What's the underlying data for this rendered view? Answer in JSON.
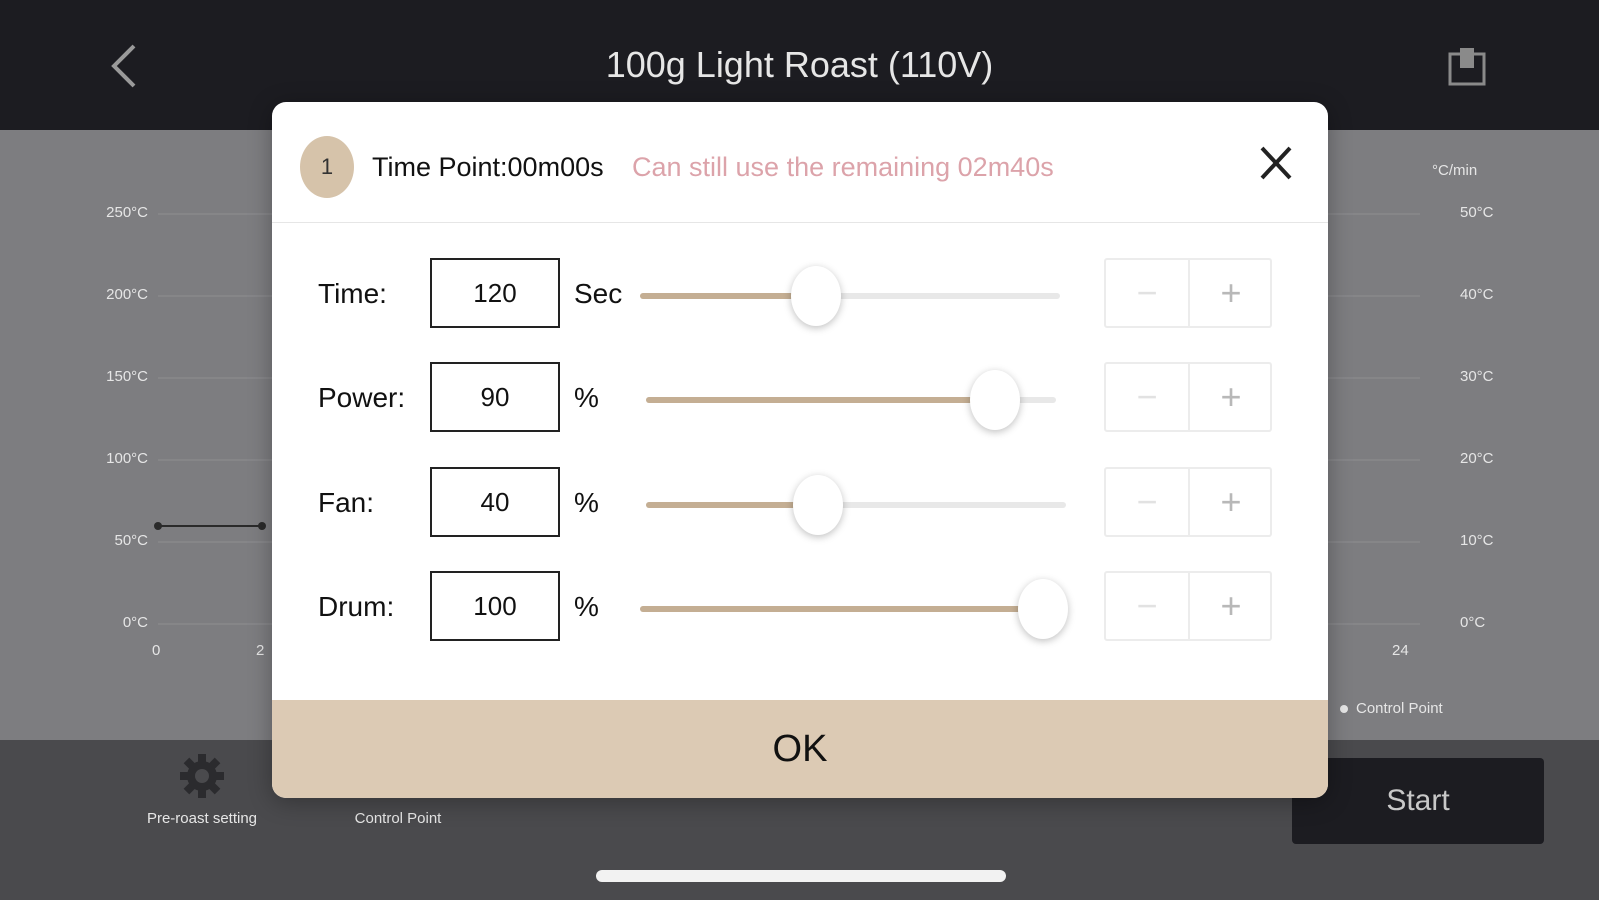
{
  "header": {
    "title": "100g Light Roast (110V)",
    "back_icon": "chevron-left-icon",
    "share_icon": "share-icon"
  },
  "chart": {
    "left_axis_ticks": [
      "250°C",
      "200°C",
      "150°C",
      "100°C",
      "50°C",
      "0°C"
    ],
    "right_axis_unit": "°C/min",
    "right_axis_ticks": [
      "50°C",
      "40°C",
      "30°C",
      "20°C",
      "10°C",
      "0°C"
    ],
    "x_ticks": [
      "0",
      "2",
      "24"
    ],
    "legend_label": "Control Point"
  },
  "toolbar": {
    "pre_roast_label": "Pre-roast setting",
    "pre_roast_icon": "gear-icon",
    "control_point_label": "Control Point",
    "start_label": "Start"
  },
  "dialog": {
    "step_number": "1",
    "time_point": "Time Point:00m00s",
    "remaining": "Can still use the remaining 02m40s",
    "close_icon": "close-icon",
    "rows": [
      {
        "label": "Time:",
        "value": "120",
        "unit": "Sec",
        "level": 0.42
      },
      {
        "label": "Power:",
        "value": "90",
        "unit": "%",
        "level": 0.85
      },
      {
        "label": "Fan:",
        "value": "40",
        "unit": "%",
        "level": 0.41
      },
      {
        "label": "Drum:",
        "value": "100",
        "unit": "%",
        "level": 0.96
      }
    ],
    "minus_symbol": "−",
    "plus_symbol": "+",
    "ok_label": "OK"
  },
  "colors": {
    "accent": "#d6c3aa",
    "ok_button": "#dccab4",
    "remaining_text": "#dca3aa",
    "top_bar": "#1c1c21"
  }
}
